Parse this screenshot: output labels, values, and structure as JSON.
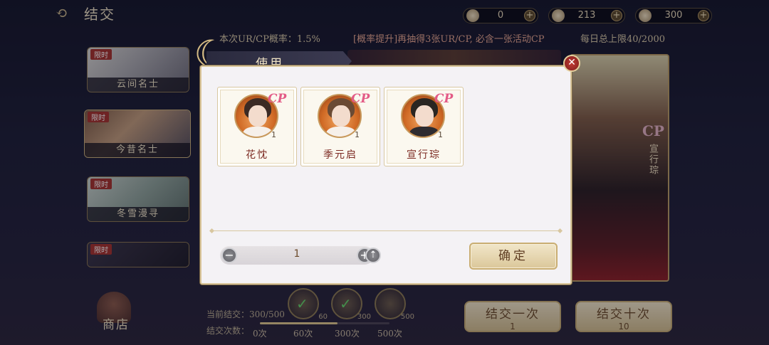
{
  "header": {
    "back_glyph": "⟲",
    "title": "结交",
    "currencies": [
      {
        "icon": "feather-token-icon",
        "value": "0"
      },
      {
        "icon": "leaf-icon",
        "value": "213"
      },
      {
        "icon": "coin-icon",
        "value": "300"
      }
    ],
    "add_glyph": "+"
  },
  "rates": {
    "label": "本次UR/CP概率：1.5%",
    "promo": "[概率提升]再抽得3张UR/CP, 必含一张活动CP",
    "daily_limit": "每日总上限40/2000"
  },
  "banners": [
    {
      "tag": "限时",
      "name": "云间名士"
    },
    {
      "tag": "限时",
      "name": "今昔名士"
    },
    {
      "tag": "限时",
      "name": "冬雪漫寻"
    },
    {
      "tag": "限时",
      "name": ""
    }
  ],
  "feature": {
    "cp_badge": "CP",
    "vertical_name": "宣行琮"
  },
  "shop": {
    "label": "商店"
  },
  "progress": {
    "current_label": "当前结交：300/500",
    "count_label": "结交次数：",
    "fraction": 0.6,
    "milestones": [
      "0次",
      "60次",
      "300次",
      "500次"
    ],
    "rewards": [
      {
        "count": "60",
        "claimed": true
      },
      {
        "count": "300",
        "claimed": true
      },
      {
        "count": "500",
        "claimed": false
      }
    ],
    "check_glyph": "✓"
  },
  "draw_buttons": {
    "once": {
      "label": "结交一次",
      "cost": "1"
    },
    "ten": {
      "label": "结交十次",
      "cost": "10"
    }
  },
  "modal": {
    "title": "使用",
    "close_glyph": "✕",
    "cards": [
      {
        "name": "花忱",
        "count": "1",
        "badge": "CP"
      },
      {
        "name": "季元启",
        "count": "1",
        "badge": "CP"
      },
      {
        "name": "宣行琮",
        "count": "1",
        "badge": "CP"
      }
    ],
    "stepper": {
      "minus": "−",
      "value": "1",
      "plus": "+",
      "max_glyph": "⇡"
    },
    "confirm_label": "确定"
  }
}
